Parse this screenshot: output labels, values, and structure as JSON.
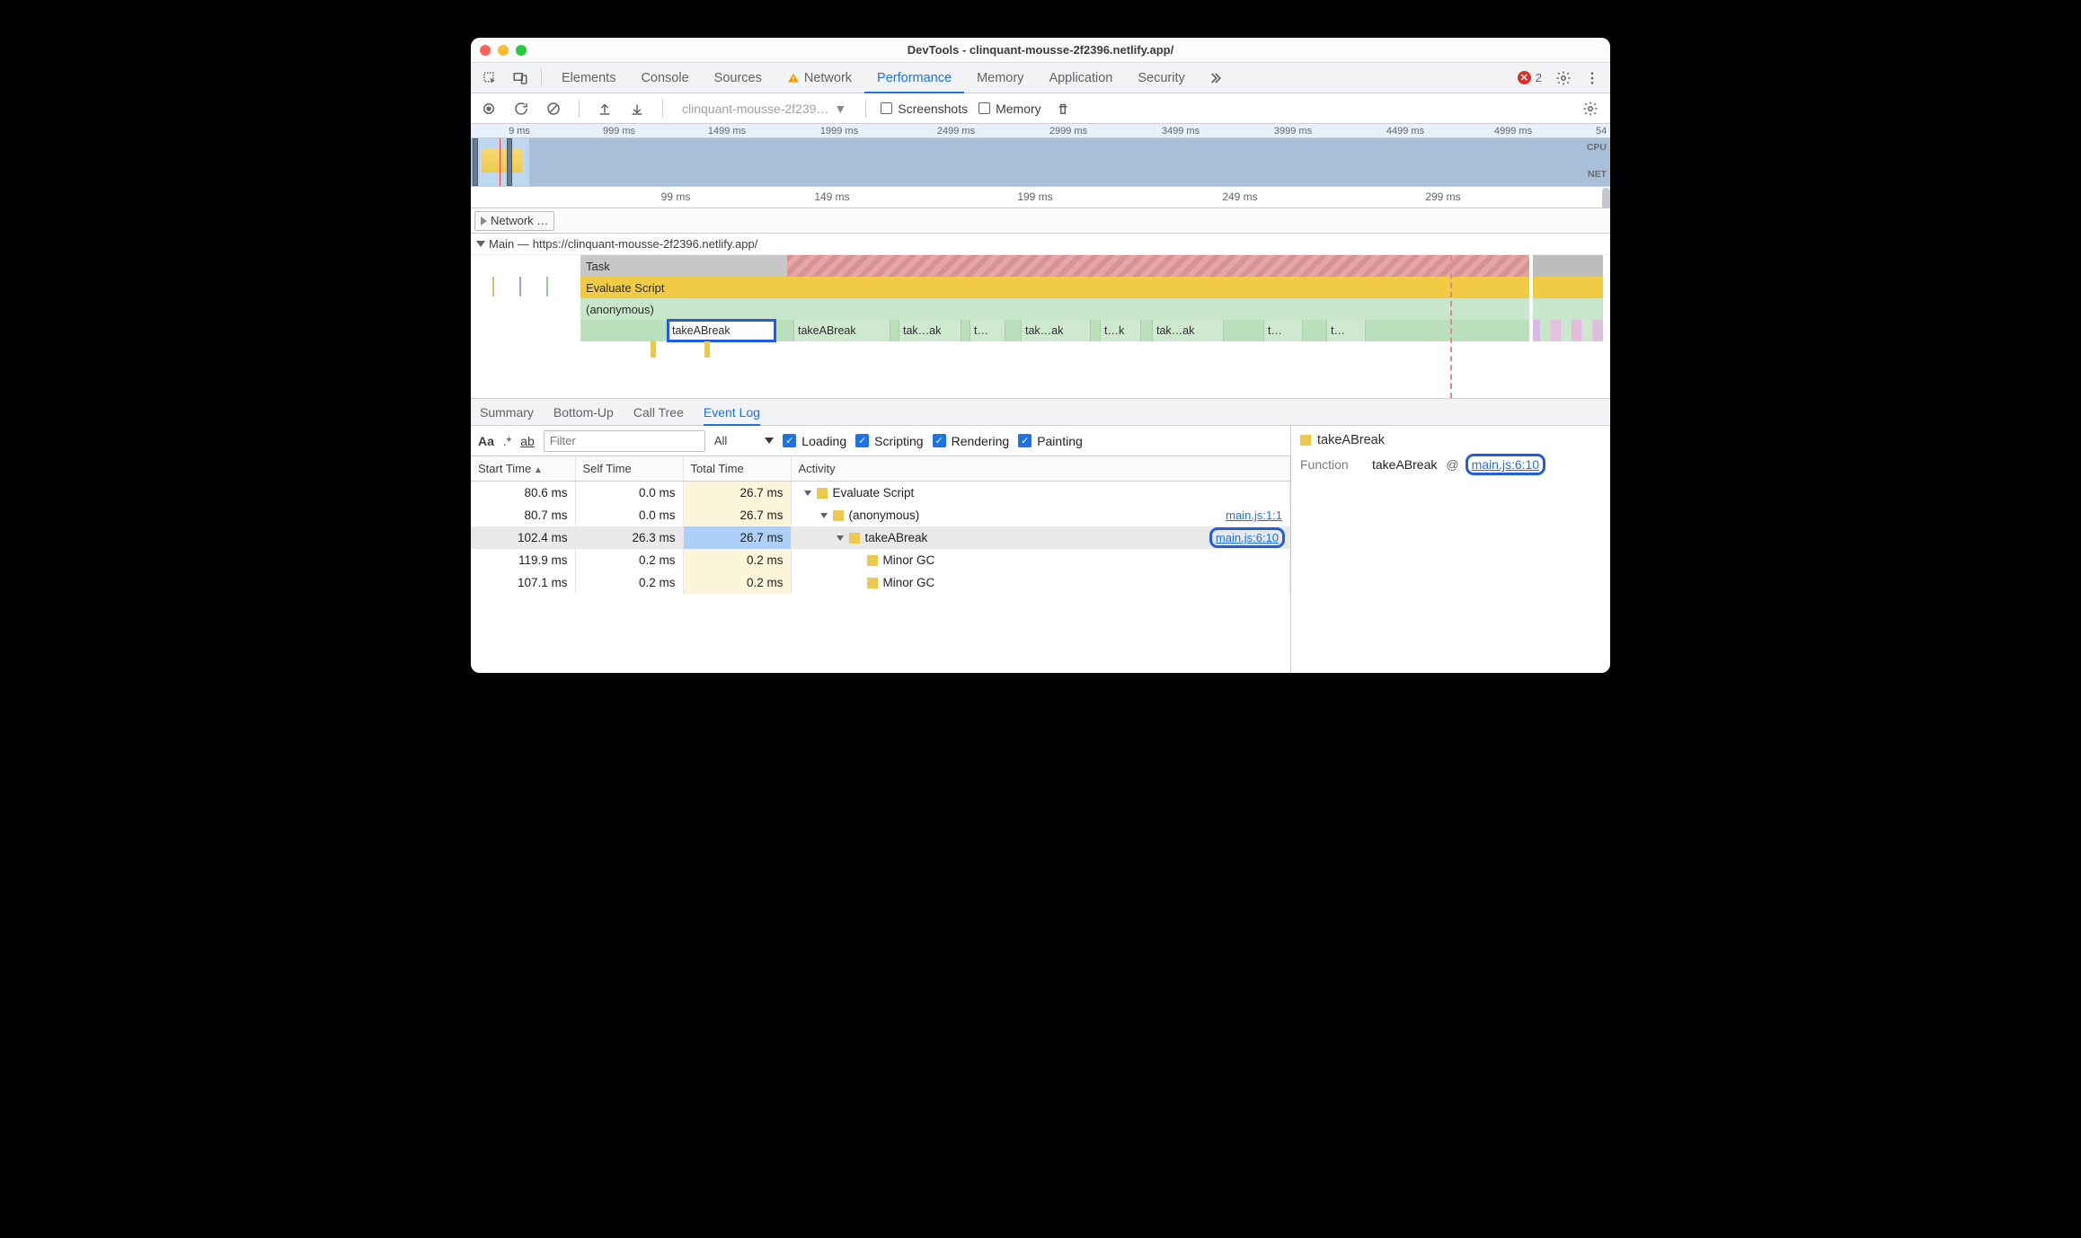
{
  "window": {
    "title": "DevTools - clinquant-mousse-2f2396.netlify.app/"
  },
  "tabs": {
    "elements": "Elements",
    "console": "Console",
    "sources": "Sources",
    "network": "Network",
    "performance": "Performance",
    "memory": "Memory",
    "application": "Application",
    "security": "Security",
    "error_count": "2"
  },
  "perfbar": {
    "profile_selector": "clinquant-mousse-2f239…",
    "screenshots_label": "Screenshots",
    "memory_label": "Memory"
  },
  "overview": {
    "ticks": [
      "9 ms",
      "999 ms",
      "1499 ms",
      "1999 ms",
      "2499 ms",
      "2999 ms",
      "3499 ms",
      "3999 ms",
      "4499 ms",
      "4999 ms",
      "54"
    ],
    "cpu_label": "CPU",
    "net_label": "NET"
  },
  "ruler": {
    "ticks": [
      "99 ms",
      "149 ms",
      "199 ms",
      "249 ms",
      "299 ms"
    ]
  },
  "network_row": {
    "label": "Network …"
  },
  "main_row": {
    "prefix": "Main —",
    "url": "https://clinquant-mousse-2f2396.netlify.app/"
  },
  "flame": {
    "task": "Task",
    "evaluate": "Evaluate Script",
    "anonymous": "(anonymous)",
    "calls": [
      "takeABreak",
      "takeABreak",
      "tak…ak",
      "t…",
      "tak…ak",
      "t…k",
      "tak…ak",
      "t…",
      "t…"
    ]
  },
  "subtabs": {
    "summary": "Summary",
    "bottomup": "Bottom-Up",
    "calltree": "Call Tree",
    "eventlog": "Event Log"
  },
  "filter": {
    "aa": "Aa",
    "regex": ".*",
    "ab": "ab",
    "placeholder": "Filter",
    "all": "All",
    "loading": "Loading",
    "scripting": "Scripting",
    "rendering": "Rendering",
    "painting": "Painting"
  },
  "table": {
    "headers": {
      "start": "Start Time",
      "self": "Self Time",
      "total": "Total Time",
      "activity": "Activity"
    },
    "rows": [
      {
        "start": "80.6 ms",
        "self": "0.0 ms",
        "total": "26.7 ms",
        "indent": 0,
        "tri": true,
        "activity": "Evaluate Script",
        "src": "",
        "selected": false
      },
      {
        "start": "80.7 ms",
        "self": "0.0 ms",
        "total": "26.7 ms",
        "indent": 1,
        "tri": true,
        "activity": "(anonymous)",
        "src": "main.js:1:1",
        "selected": false
      },
      {
        "start": "102.4 ms",
        "self": "26.3 ms",
        "total": "26.7 ms",
        "indent": 2,
        "tri": true,
        "activity": "takeABreak",
        "src": "main.js:6:10",
        "selected": true,
        "srchl": true
      },
      {
        "start": "119.9 ms",
        "self": "0.2 ms",
        "total": "0.2 ms",
        "indent": 3,
        "tri": false,
        "activity": "Minor GC",
        "src": "",
        "selected": false
      },
      {
        "start": "107.1 ms",
        "self": "0.2 ms",
        "total": "0.2 ms",
        "indent": 3,
        "tri": false,
        "activity": "Minor GC",
        "src": "",
        "selected": false
      }
    ]
  },
  "sidepanel": {
    "title": "takeABreak",
    "function_label": "Function",
    "function_name": "takeABreak",
    "at": "@",
    "src": "main.js:6:10"
  }
}
